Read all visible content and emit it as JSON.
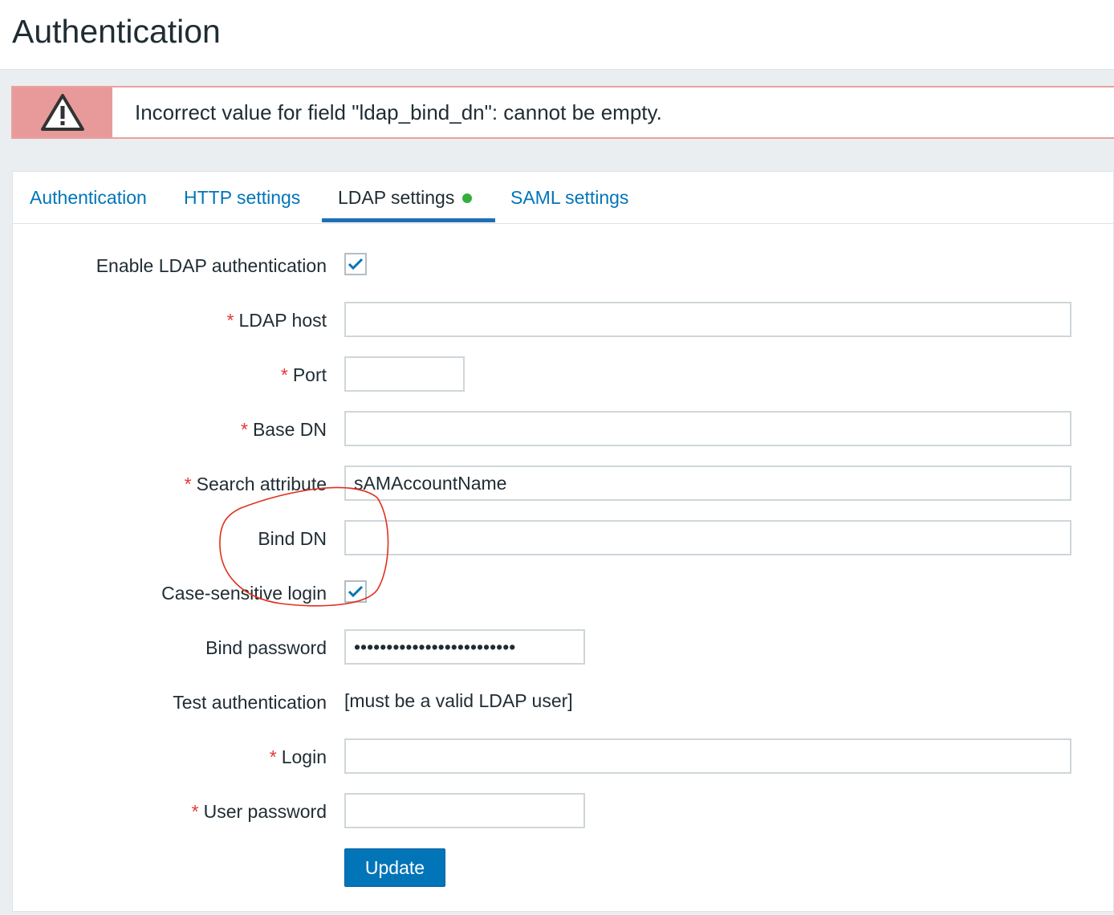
{
  "page": {
    "title": "Authentication"
  },
  "alert": {
    "message": "Incorrect value for field \"ldap_bind_dn\": cannot be empty.",
    "icon": "warning-triangle-icon",
    "colors": {
      "icon_bg": "#e89a9a",
      "border": "#e8a1a1"
    }
  },
  "tabs": [
    {
      "label": "Authentication",
      "active": false
    },
    {
      "label": "HTTP settings",
      "active": false
    },
    {
      "label": "LDAP settings",
      "active": true,
      "indicator": "green-dot"
    },
    {
      "label": "SAML settings",
      "active": false
    }
  ],
  "form": {
    "enable_ldap": {
      "label": "Enable LDAP authentication",
      "checked": true
    },
    "ldap_host": {
      "label": "LDAP host",
      "required": true,
      "value": ""
    },
    "port": {
      "label": "Port",
      "required": true,
      "value": ""
    },
    "base_dn": {
      "label": "Base DN",
      "required": true,
      "value": ""
    },
    "search_attribute": {
      "label": "Search attribute",
      "required": true,
      "value": "sAMAccountName"
    },
    "bind_dn": {
      "label": "Bind DN",
      "required": false,
      "value": ""
    },
    "case_sensitive": {
      "label": "Case-sensitive login",
      "checked": true
    },
    "bind_password": {
      "label": "Bind password",
      "value": "•••••••••••••••••••••••••"
    },
    "test_auth": {
      "label": "Test authentication",
      "note": "[must be a valid LDAP user]"
    },
    "login": {
      "label": "Login",
      "required": true,
      "value": ""
    },
    "user_password": {
      "label": "User password",
      "required": true,
      "value": ""
    },
    "required_mark": "*",
    "update_label": "Update"
  },
  "colors": {
    "accent": "#0275b8",
    "required": "#e33734",
    "active_dot": "#34af3a",
    "annotation": "#e0301e"
  }
}
